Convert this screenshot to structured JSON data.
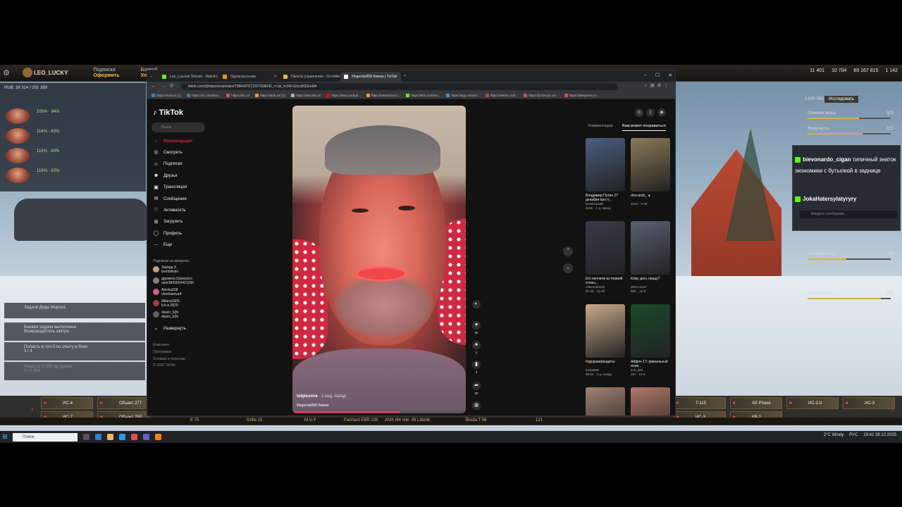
{
  "game": {
    "player": "LEO_LUCKY",
    "subscription": "Подписка",
    "subscribe_action": "Оформить",
    "boost": "Боевой",
    "boost_action": "Улучшит",
    "currency": [
      "11 401",
      "10 704",
      "65 167 815",
      "1 142"
    ],
    "gold_stat": "RUB: 38 314 / 291 389",
    "crew": [
      {
        "pct": "105%",
        "sub": "94%"
      },
      {
        "pct": "116%",
        "sub": "83%"
      },
      {
        "pct": "116%",
        "sub": "83%"
      },
      {
        "pct": "116%",
        "sub": "83%"
      }
    ],
    "missions": [
      {
        "title": "Задачи Деда Мороза",
        "note": ""
      },
      {
        "title": "Боевая задача выполнена",
        "note": "Возвращайтесь завтра"
      },
      {
        "title": "Попасть в топ-5 по опыту в боях",
        "note": "3 / 4"
      },
      {
        "title": "Нанести 5 000 ед. урона",
        "note": "0 / 1 500"
      }
    ],
    "skills_header": {
      "value": "2 830 066",
      "button": "Исследовать"
    },
    "skills": [
      {
        "name": "Огневая мощь",
        "value": "303",
        "fill": 0.62
      },
      {
        "name": "Живучесть",
        "value": "317",
        "fill": 0.66
      },
      {
        "name": "Незаметность",
        "value": "226",
        "fill": 0.47
      },
      {
        "name": "Наблюдение",
        "value": "562",
        "fill": 0.88
      }
    ],
    "tanks_row1": [
      "ИС-4",
      "Объект 277",
      "",
      "",
      "",
      "",
      "",
      "",
      "",
      "",
      "",
      "",
      "",
      "T-115",
      "AE Phase",
      "ИС-2-II",
      "ИС-3"
    ],
    "tanks_row2": [
      "ИС-7",
      "Объект 780",
      "",
      "",
      "",
      "",
      "",
      "",
      "",
      "",
      "",
      "",
      "",
      "ИС-3",
      "КВ-2",
      "",
      ""
    ],
    "strip": [
      "E 75",
      "Grille 15",
      "M-V-Y",
      "Panhard EBR 105",
      "AMX M4 mle. 49 Liberté",
      "Škoda T 56",
      "121"
    ]
  },
  "chat": {
    "messages": [
      {
        "user": "bievonardo_cigan",
        "text": "типичный знаток экономики с бутылкой в заднице"
      },
      {
        "user": "JokaHatersylatyryry",
        "text": ""
      }
    ],
    "placeholder": "Введите сообщение..."
  },
  "browser": {
    "tabs": [
      {
        "title": "Leo_Lucoste Stream - Watch L",
        "color": "#53fc18"
      },
      {
        "title": "Одноклассники",
        "color": "#f7931e"
      },
      {
        "title": "Панель управления - Остатки",
        "color": "#e8b84a"
      },
      {
        "title": "#legenda858 #мема | TikTok",
        "color": "#ffffff",
        "active": true
      }
    ],
    "url": "tiktok.com/@tolpisvova/video/7586497073707028042_r=1&_t=ZM-92ocd62GmM4",
    "bookmarks": [
      {
        "label": "https://mail.ru/ (1)",
        "color": "#168de2"
      },
      {
        "label": "https://vk.com/id19...",
        "color": "#4a76a8"
      },
      {
        "label": "https://slu.ru/",
        "color": "#e84a4a"
      },
      {
        "label": "https://tank.su/ (1)",
        "color": "#f7931e"
      },
      {
        "label": "https://lostclub.ru/",
        "color": "#aaaaaa"
      },
      {
        "label": "https://www.youtub...",
        "color": "#ff0000"
      },
      {
        "label": "https://www.timnu.r...",
        "color": "#f7931e"
      },
      {
        "label": "https://kick.com/leo...",
        "color": "#53fc18"
      },
      {
        "label": "https://app.eslotes...",
        "color": "#4a90e2"
      },
      {
        "label": "https://stehno.md/...",
        "color": "#c04040"
      },
      {
        "label": "https://prime-pc.md...",
        "color": "#e84a4a"
      },
      {
        "label": "https://aliexpress.ru...",
        "color": "#e84a4a"
      }
    ]
  },
  "tiktok": {
    "logo": "TikTok",
    "search_placeholder": "Поиск",
    "nav": [
      {
        "label": "Рекомендации",
        "icon": "home-icon",
        "glyph": "⌂",
        "active": true
      },
      {
        "label": "Смотреть",
        "icon": "compass-icon",
        "glyph": "◎"
      },
      {
        "label": "Подписки",
        "icon": "following-icon",
        "glyph": "☺"
      },
      {
        "label": "Друзья",
        "icon": "friends-icon",
        "glyph": "☻"
      },
      {
        "label": "Трансляция",
        "icon": "live-icon",
        "glyph": "▣"
      },
      {
        "label": "Сообщения",
        "icon": "messages-icon",
        "glyph": "✉"
      },
      {
        "label": "Активность",
        "icon": "activity-icon",
        "glyph": "♡"
      },
      {
        "label": "Загрузить",
        "icon": "upload-icon",
        "glyph": "⊞"
      },
      {
        "label": "Профиль",
        "icon": "profile-icon",
        "glyph": "◯"
      },
      {
        "label": "Еще",
        "icon": "more-icon",
        "glyph": "⋯"
      }
    ],
    "following_header": "Подписки на аккаунты",
    "following": [
      {
        "name": "Зауирд Х",
        "handle": "bombitsolo",
        "color": "#c0a080"
      },
      {
        "name": "дружина Шумского",
        "handle": "user3842654421396",
        "color": "#808080"
      },
      {
        "name": "Aleska228",
        "handle": "cherkasova4",
        "color": "#d06080"
      },
      {
        "name": "Milana1005",
        "handle": "b.b.b.2829",
        "color": "#a04040"
      },
      {
        "name": "diavlo_b2b",
        "handle": "diavlo_b2b",
        "color": "#606060"
      }
    ],
    "expand": "Развернуть",
    "footer": [
      "Компания",
      "Программа",
      "Условия и политики",
      "© 2025 TikTok"
    ],
    "video": {
      "author": "tolpisvova",
      "time": " · 1 нед. назад",
      "tags": "#legenda858 #мема"
    },
    "actions": [
      {
        "name": "avatar-action",
        "glyph": "◐",
        "count": ""
      },
      {
        "name": "like-icon",
        "glyph": "♥",
        "count": "50"
      },
      {
        "name": "comment-icon",
        "glyph": "●",
        "count": "2"
      },
      {
        "name": "bookmark-icon",
        "glyph": "▮",
        "count": "3"
      },
      {
        "name": "share-icon",
        "glyph": "➦",
        "count": "30"
      },
      {
        "name": "sound-icon",
        "glyph": "◍",
        "count": ""
      }
    ],
    "right_tabs": [
      "Комментарии",
      "Вам может понравиться"
    ],
    "cards": [
      {
        "title": "Владимир Путин 27 декабря про н...",
        "author": "ksuskinpo69",
        "stats": "433K · 1 д. назад",
        "color": "#4a5e80"
      },
      {
        "title": "doccardo_ ●",
        "author": "",
        "stats": "341K · 9-28",
        "color": "#8a7a58"
      },
      {
        "title": "Его кончили из первой стены...",
        "author": "malvordiniesk",
        "stats": "81.6K · 10-25",
        "color": "#3a3a4a"
      },
      {
        "title": "Кому дать пиццу?",
        "author": "dimm.soon",
        "stats": "80K · 12-9",
        "color": "#5a6070"
      },
      {
        "title": "#здоровабандиты",
        "author": "foxbo666",
        "stats": "38.6K · 2 д. назад",
        "color": "#c8a888"
      },
      {
        "title": "Айфон 17: финальный плев...",
        "author": "tom_k89",
        "stats": "367 · 12-9",
        "color": "#1a4a2a"
      },
      {
        "title": "",
        "author": "",
        "stats": "",
        "color": "#a08070"
      },
      {
        "title": "",
        "author": "",
        "stats": "",
        "color": "#b07868"
      }
    ]
  },
  "taskbar": {
    "search": "Поиск",
    "weather": "2°C Windy",
    "lang": "РУС",
    "time": "19:42",
    "date": "28.12.2025"
  }
}
